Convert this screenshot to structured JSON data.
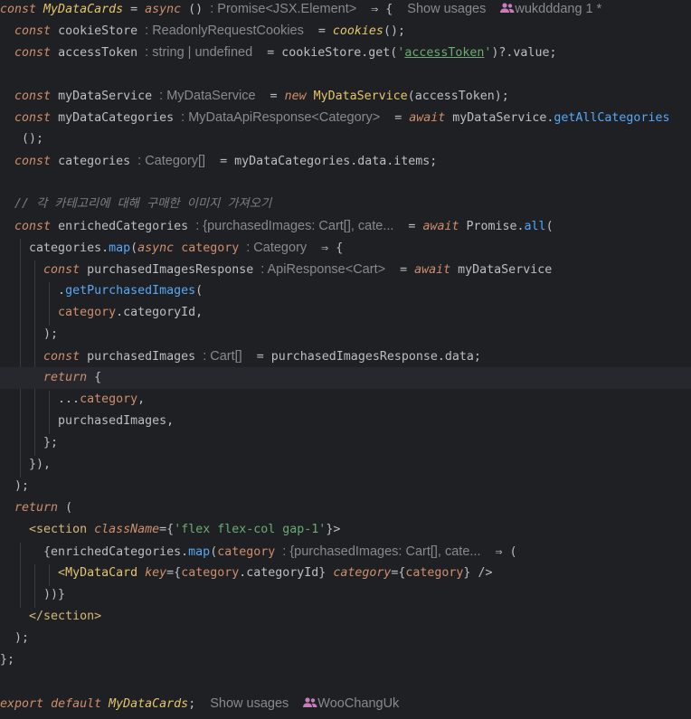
{
  "header": {
    "kw_const": "const",
    "name": "MyDataCards",
    "eq": " = ",
    "kw_async": "async",
    "parens": " ()",
    "type_hint": ": Promise<JSX.Element>",
    "arrow": " ⇒ {",
    "usages": "Show usages",
    "author": "wukdddang 1 *"
  },
  "code": {
    "cookieStore": "cookieStore",
    "cookieStore_hint": ": ReadonlyRequestCookies",
    "cookies_fn": "cookies",
    "accessToken": "accessToken",
    "accessToken_hint": ": string | undefined",
    "cookieStoreGet": " = cookieStore.get(",
    "accessToken_str": "accessToken",
    "valueTail": ")?.value;",
    "myDataService": "myDataService",
    "myDataService_hint": ": MyDataService",
    "kw_new": "new",
    "MyDataService_cls": "MyDataService",
    "svcArgs": "(accessToken);",
    "myDataCategories": "myDataCategories",
    "myDataCategories_hint": ": MyDataApiResponse<Category>",
    "kw_await": "await",
    "svcDot": " myDataService.",
    "getAllCategories": "getAllCategories",
    "callEnd": "();",
    "categories": "categories",
    "categories_hint": ": Category[]",
    "catAssign": " = myDataCategories.data.items;",
    "comment": "// 각 카테고리에 대해 구매한 이미지 가져오기",
    "enrichedCategories": "enrichedCategories",
    "enriched_hint": ": {purchasedImages: Cart[], cate...",
    "promise": " Promise.",
    "all_fn": "all",
    "open_paren": "(",
    "catMap": "categories.",
    "map_fn": "map",
    "category_param": "category",
    "category_hint": ": Category",
    "arrow_open": " ⇒ {",
    "purchasedImagesResponse": "purchasedImagesResponse",
    "pir_hint": ": ApiResponse<Cart>",
    "svcName": " myDataService",
    "dot": ".",
    "getPurchasedImages": "getPurchasedImages",
    "categoryId_ref": ".categoryId,",
    "close_paren_semi": ");",
    "purchasedImages": "purchasedImages",
    "pi_hint": ": Cart[]",
    "piAssign": " = purchasedImagesResponse.data;",
    "kw_return": "return",
    "brace_open": " {",
    "spread": "...",
    "comma": ",",
    "purchasedImages_prop": "purchasedImages,",
    "brace_close_semi": "};",
    "map_close": "}),",
    "return_paren": " (",
    "lt": "<",
    "section_tag": "section",
    "className_attr": "className",
    "eq_brace": "={",
    "class_str": "'flex flex-col gap-1'",
    "brace_gt": "}>",
    "enrMap": "{enrichedCategories.",
    "enr_hint": ": {purchasedImages: Cart[], cate...",
    "arrow_paren": " ⇒ (",
    "card_tag": "MyDataCard",
    "key_attr": "key",
    "key_val": "category.categoryId",
    "category_attr": "category",
    "self_close": " />",
    "close_jsx": "))}",
    "lt_slash": "</",
    "gt": ">",
    "paren_semi": ");",
    "func_close": "};"
  },
  "footer": {
    "kw_export": "export",
    "kw_default": "default",
    "export_name": "MyDataCards",
    "semi": ";",
    "usages": "Show usages",
    "author": "WooChangUk"
  }
}
